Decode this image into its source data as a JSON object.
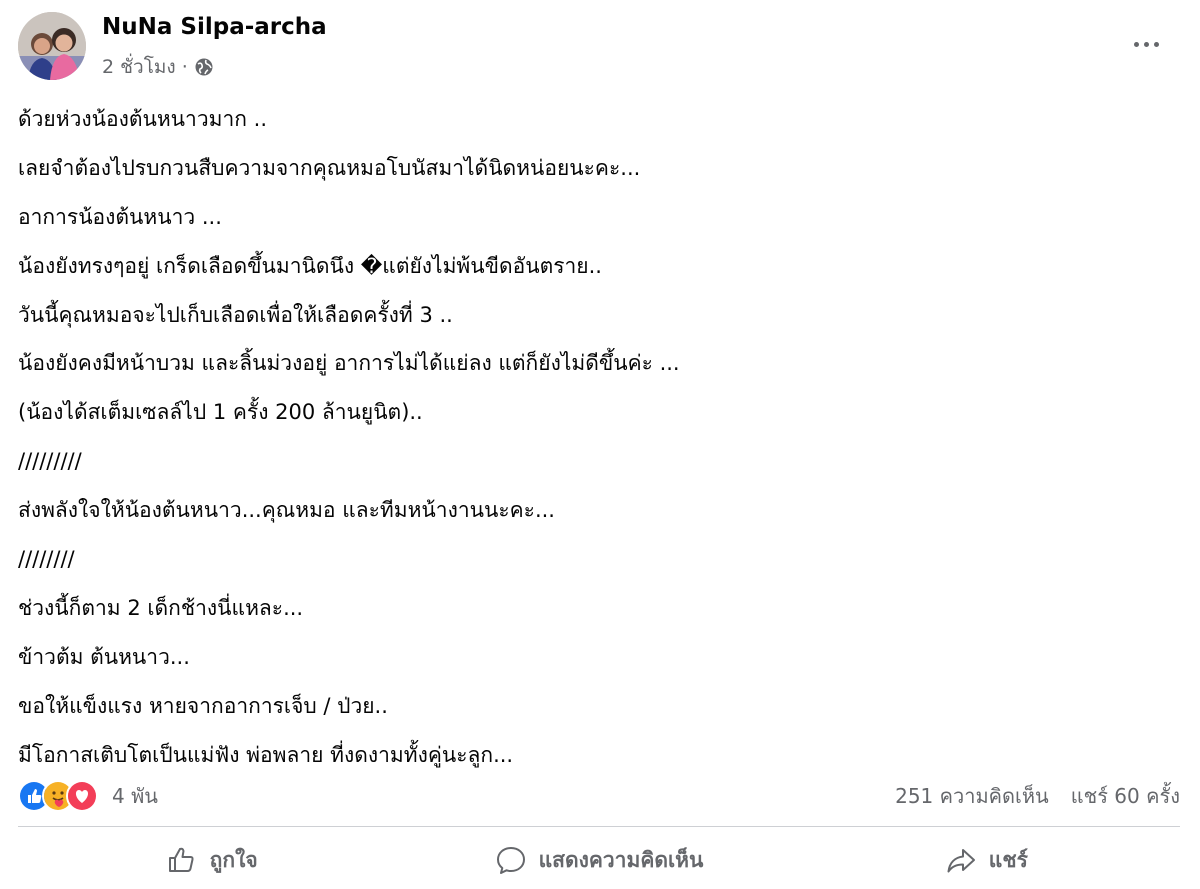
{
  "post": {
    "author": "NuNa Silpa-archa",
    "timestamp": "2 ชั่วโมง",
    "separator": "·",
    "audience_icon": "globe-icon",
    "more_icon": "more-options-icon",
    "lines": [
      "ด้วยห่วงน้องต้นหนาวมาก ..",
      "เลยจำต้องไปรบกวนสืบความจากคุณหมอโบนัสมาได้นิดหน่อยนะคะ...",
      "อาการน้องต้นหนาว ...",
      "น้องยังทรงๆอยู่ เกร็ดเลือดขึ้นมานิดนึง �แต่ยังไม่พ้นขีดอันตราย..",
      "วันนี้คุณหมอจะไปเก็บเลือดเพื่อให้เลือดครั้งที่ 3 ..",
      "น้องยังคงมีหน้าบวม และลิ้นม่วงอยู่ อาการไม่ได้แย่ลง แต่ก็ยังไม่ดีขึ้นค่ะ ...",
      "(น้องได้สเต็มเซลล์ไป 1 ครั้ง 200 ล้านยูนิต)..",
      "/////////",
      "ส่งพลังใจให้น้องต้นหนาว...คุณหมอ และทีมหน้างานนะคะ...",
      "////////",
      "ช่วงนี้ก็ตาม 2 เด็กช้างนี่แหละ...",
      "ข้าวต้ม ต้นหนาว...",
      "ขอให้แข็งแรง หายจากอาการเจ็บ / ป่วย..",
      "มีโอกาสเติบโตเป็นแม่ฟัง พ่อพลาย ที่งดงามทั้งคู่นะลูก..."
    ]
  },
  "stats": {
    "reactions": [
      "like-icon",
      "care-icon",
      "love-icon"
    ],
    "reaction_count": "4 พัน",
    "comments": "251 ความคิดเห็น",
    "shares": "แชร์ 60 ครั้ง"
  },
  "actions": {
    "like_label": "ถูกใจ",
    "comment_label": "แสดงความคิดเห็น",
    "share_label": "แชร์"
  },
  "colors": {
    "text": "#050505",
    "secondary": "#65676b",
    "like_blue": "#1877f2",
    "love_red": "#f33e58",
    "care_yellow": "#f7b125"
  }
}
